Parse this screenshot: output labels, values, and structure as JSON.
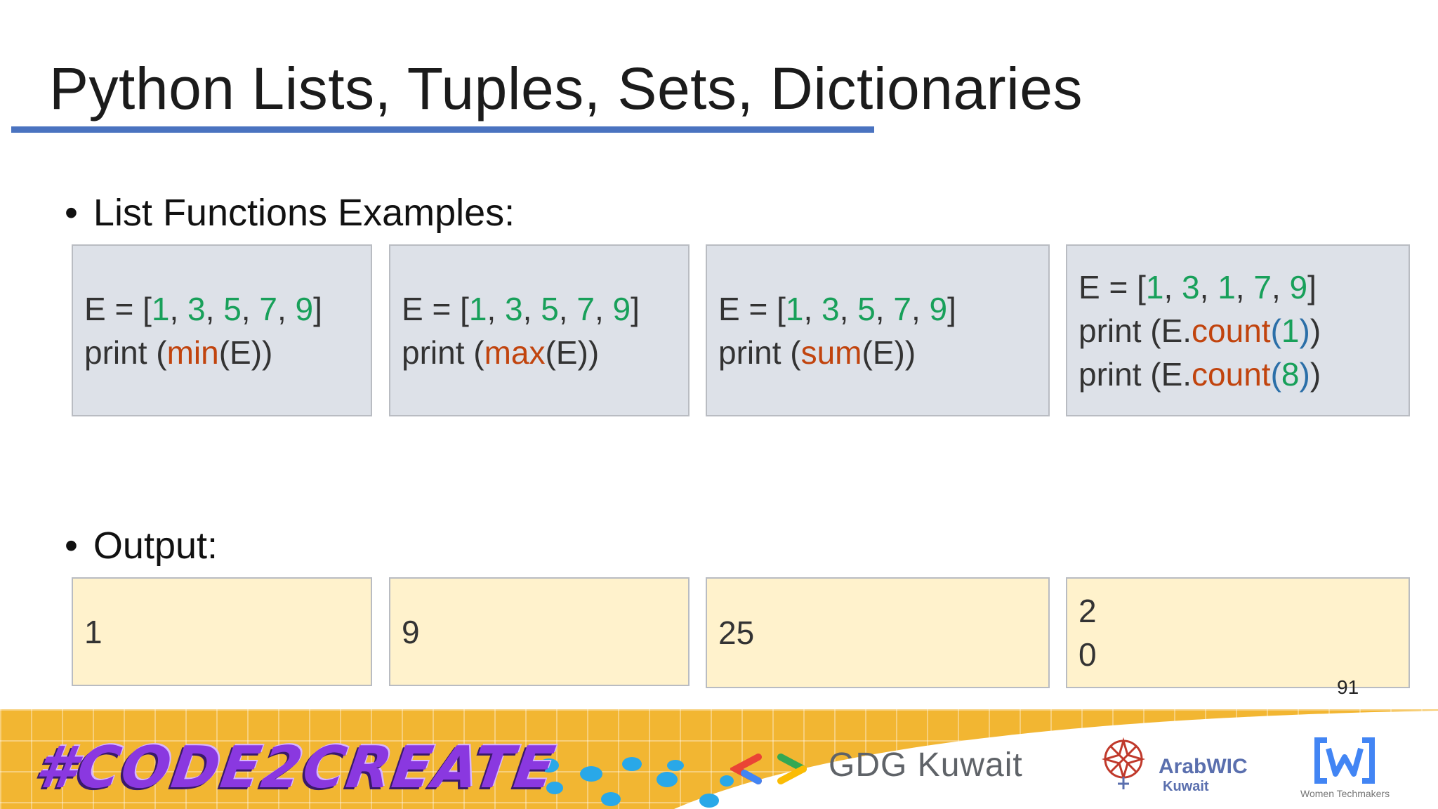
{
  "slide": {
    "title": "Python Lists, Tuples, Sets, Dictionaries",
    "page_number": "91"
  },
  "sections": {
    "examples_label": "List Functions Examples:",
    "output_label": "Output:"
  },
  "code_boxes": [
    {
      "lines": [
        [
          "E = [",
          {
            "n": "1"
          },
          ", ",
          {
            "n": "3"
          },
          ", ",
          {
            "n": "5"
          },
          ", ",
          {
            "n": "7"
          },
          ", ",
          {
            "n": "9"
          },
          "]"
        ],
        [
          "print (",
          {
            "f": "min"
          },
          "(E))"
        ]
      ]
    },
    {
      "lines": [
        [
          "E = [",
          {
            "n": "1"
          },
          ", ",
          {
            "n": "3"
          },
          ", ",
          {
            "n": "5"
          },
          ", ",
          {
            "n": "7"
          },
          ", ",
          {
            "n": "9"
          },
          "]"
        ],
        [
          "print (",
          {
            "f": "max"
          },
          "(E))"
        ]
      ]
    },
    {
      "lines": [
        [
          "E = [",
          {
            "n": "1"
          },
          ", ",
          {
            "n": "3"
          },
          ", ",
          {
            "n": "5"
          },
          ", ",
          {
            "n": "7"
          },
          ", ",
          {
            "n": "9"
          },
          "]"
        ],
        [
          "print (",
          {
            "f": "sum"
          },
          "(E))"
        ]
      ]
    },
    {
      "lines": [
        [
          "E = [",
          {
            "n": "1"
          },
          ", ",
          {
            "n": "3"
          },
          ", ",
          {
            "n": "1"
          },
          ", ",
          {
            "n": "7"
          },
          ", ",
          {
            "n": "9"
          },
          "]"
        ],
        [
          "print (E.",
          {
            "f": "count"
          },
          {
            "p": "("
          },
          {
            "n": "1"
          },
          {
            "p": ")"
          },
          ")"
        ],
        [
          "print (E.",
          {
            "f": "count"
          },
          {
            "p": "("
          },
          {
            "n": "8"
          },
          {
            "p": ")"
          },
          ")"
        ]
      ]
    }
  ],
  "outputs": [
    {
      "lines": [
        "1"
      ]
    },
    {
      "lines": [
        "9"
      ]
    },
    {
      "lines": [
        "25"
      ]
    },
    {
      "lines": [
        "2",
        "0"
      ]
    }
  ],
  "banner": {
    "hashtag": "#CODE2CREATE",
    "gdg": "GDG Kuwait",
    "arabwic": "ArabWIC",
    "arabwic_sub": "Kuwait",
    "wtm": "Women Techmakers"
  },
  "colors": {
    "number": "#18a05a",
    "function": "#c1440e",
    "paren": "#2b6fa8",
    "code_bg": "#dde1e8",
    "output_bg": "#fff2cc",
    "title_rule": "#4a73c0"
  }
}
